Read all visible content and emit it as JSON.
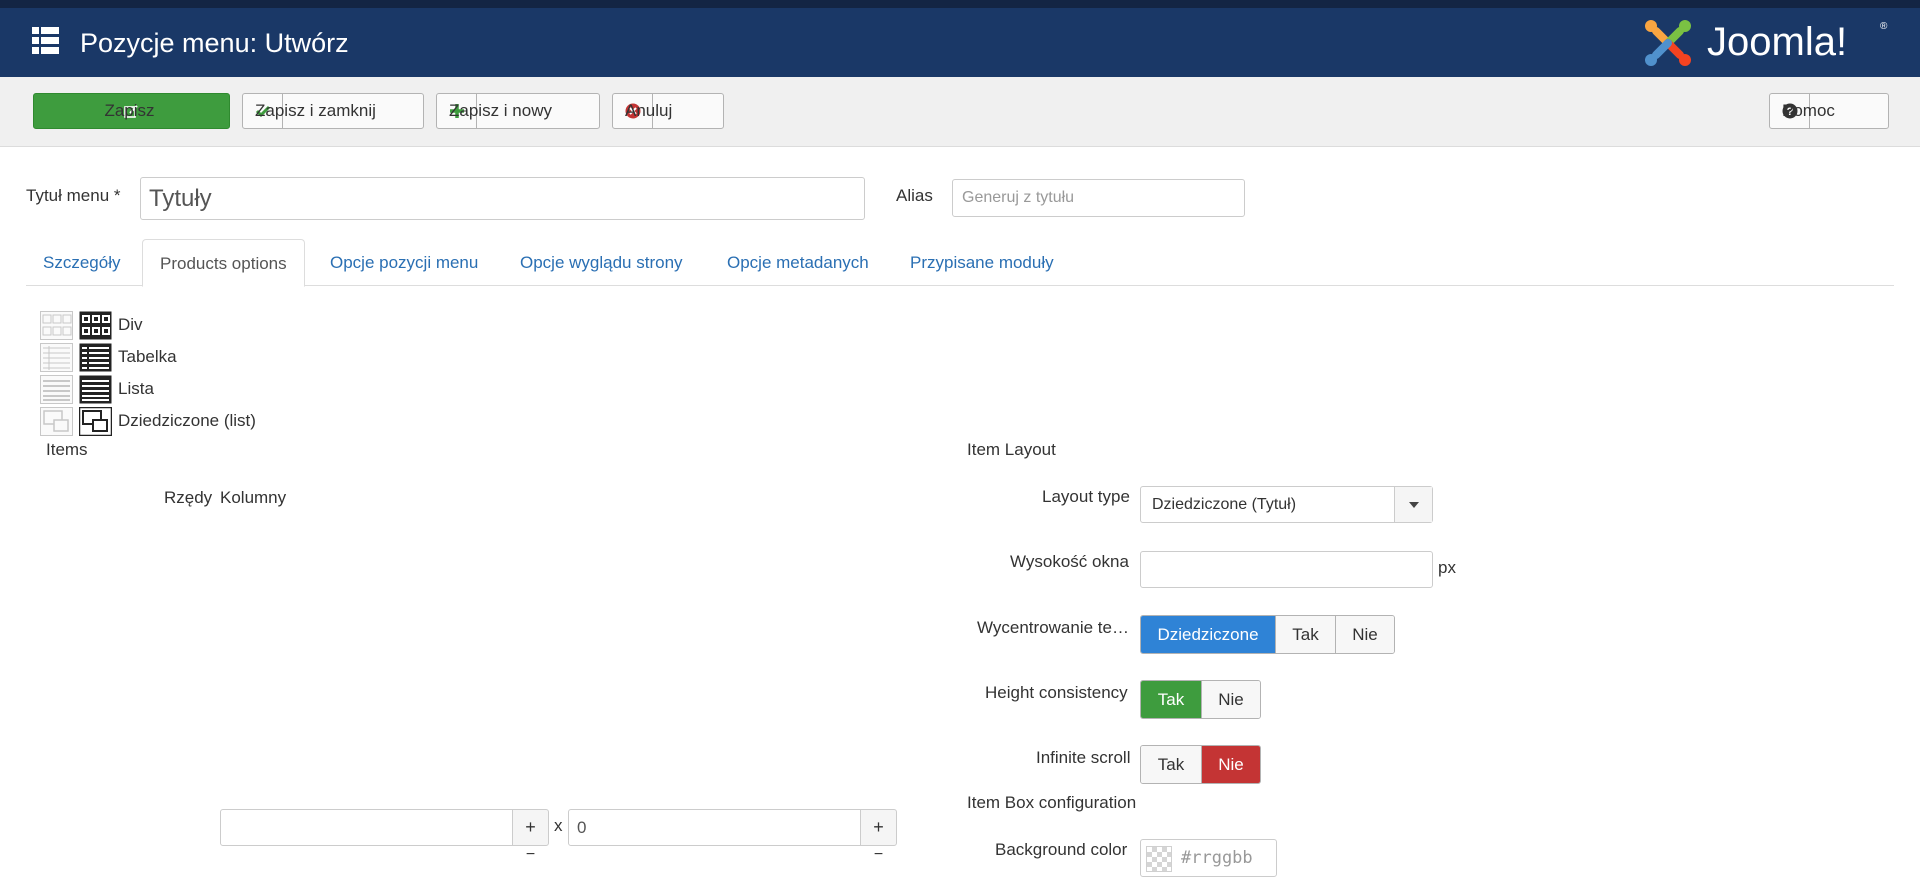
{
  "header": {
    "title": "Pozycje menu: Utwórz",
    "logo_text": "Joomla!",
    "logo_mark": "®"
  },
  "toolbar": {
    "save": "Zapisz",
    "save_close": "Zapisz i zamknij",
    "save_new": "Zapisz i nowy",
    "cancel": "Anuluj",
    "help": "Pomoc"
  },
  "form": {
    "title_label": "Tytuł menu *",
    "title_value": "Tytuły",
    "alias_label": "Alias",
    "alias_placeholder": "Generuj z tytułu"
  },
  "tabs": [
    {
      "label": "Szczegóły",
      "active": false
    },
    {
      "label": "Products options",
      "active": true
    },
    {
      "label": "Opcje pozycji menu",
      "active": false
    },
    {
      "label": "Opcje wyglądu strony",
      "active": false
    },
    {
      "label": "Opcje metadanych",
      "active": false
    },
    {
      "label": "Przypisane moduły",
      "active": false
    }
  ],
  "layouts": [
    {
      "label": "Div",
      "icon": "div-grid-icon"
    },
    {
      "label": "Tabelka",
      "icon": "table-layout-icon"
    },
    {
      "label": "Lista",
      "icon": "list-layout-icon"
    },
    {
      "label": "Dziedziczone (list)",
      "icon": "inherited-layout-icon"
    }
  ],
  "items": {
    "heading": "Items",
    "rows_label": "Rzędy",
    "columns_label": "Kolumny",
    "rows_value": "",
    "columns_value": "0",
    "x_sep": "x",
    "plus": "+",
    "minus": "−"
  },
  "item_layout": {
    "heading": "Item Layout",
    "layout_type_label": "Layout type",
    "layout_type_value": "Dziedziczone (Tytuł)",
    "window_height_label": "Wysokość okna",
    "window_height_unit": "px",
    "center_label": "Wycentrowanie te…",
    "center_options": [
      "Dziedziczone",
      "Tak",
      "Nie"
    ],
    "height_consistency_label": "Height consistency",
    "height_consistency_options": [
      "Tak",
      "Nie"
    ],
    "infinite_scroll_label": "Infinite scroll",
    "infinite_scroll_options": [
      "Tak",
      "Nie"
    ]
  },
  "item_box": {
    "heading": "Item Box configuration",
    "bg_label": "Background color",
    "bg_placeholder": "#rrggbb"
  },
  "colors": {
    "header_bg": "#1a3867",
    "save_green": "#3e9c3e",
    "active_blue": "#2f83d6",
    "active_red": "#c43434",
    "link_blue": "#2a6fb3"
  }
}
